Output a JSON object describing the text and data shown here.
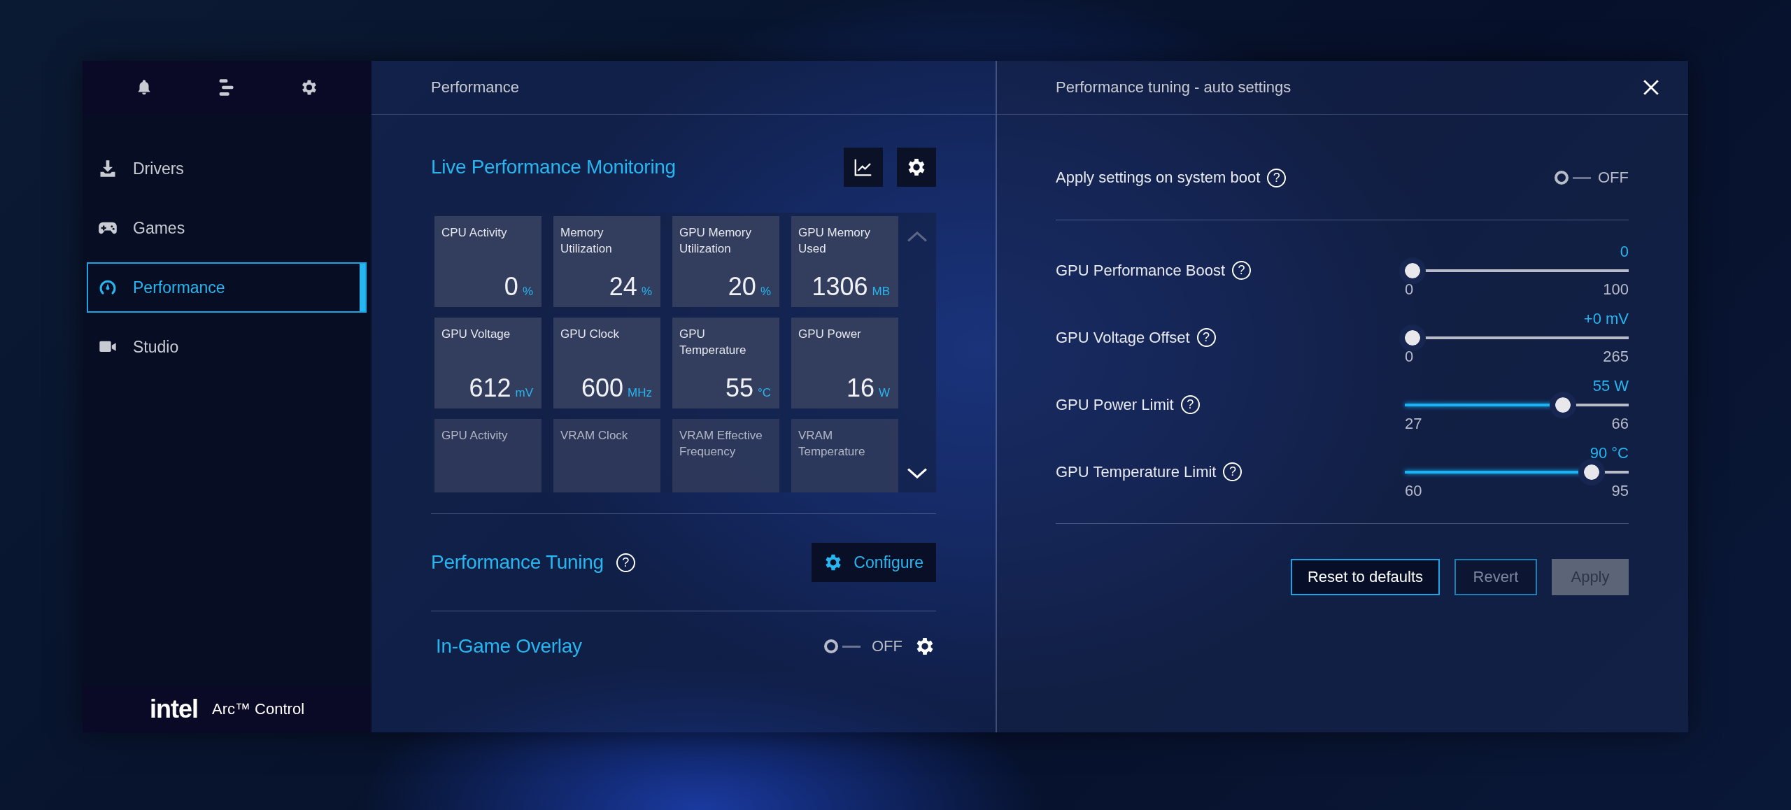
{
  "sidebar": {
    "items": [
      {
        "label": "Drivers",
        "selected": false
      },
      {
        "label": "Games",
        "selected": false
      },
      {
        "label": "Performance",
        "selected": true
      },
      {
        "label": "Studio",
        "selected": false
      }
    ],
    "brand": {
      "logo": "intel",
      "product": "Arc™ Control"
    }
  },
  "center": {
    "title": "Performance",
    "monitoring": {
      "title": "Live Performance Monitoring",
      "tiles": [
        {
          "label": "CPU Activity",
          "value": "0",
          "unit": "%"
        },
        {
          "label": "Memory Utilization",
          "value": "24",
          "unit": "%"
        },
        {
          "label": "GPU Memory Utilization",
          "value": "20",
          "unit": "%"
        },
        {
          "label": "GPU Memory Used",
          "value": "1306",
          "unit": "MB"
        },
        {
          "label": "GPU Voltage",
          "value": "612",
          "unit": "mV"
        },
        {
          "label": "GPU Clock",
          "value": "600",
          "unit": "MHz"
        },
        {
          "label": "GPU Temperature",
          "value": "55",
          "unit": "°C"
        },
        {
          "label": "GPU Power",
          "value": "16",
          "unit": "W"
        },
        {
          "label": "GPU Activity"
        },
        {
          "label": "VRAM Clock"
        },
        {
          "label": "VRAM Effective Frequency"
        },
        {
          "label": "VRAM Temperature"
        }
      ]
    },
    "tuning": {
      "title": "Performance Tuning",
      "help": "?",
      "button": "Configure"
    },
    "overlay": {
      "title": "In-Game Overlay",
      "on": false,
      "state_label": "OFF"
    }
  },
  "right": {
    "title": "Performance tuning - auto settings",
    "boot": {
      "label": "Apply settings on system boot",
      "help": "?",
      "on": false,
      "state_label": "OFF"
    },
    "sliders": [
      {
        "label": "GPU Performance Boost",
        "help": "?",
        "reading": "0",
        "min": "0",
        "max": "100",
        "level": 0
      },
      {
        "label": "GPU Voltage Offset",
        "help": "?",
        "reading": "+0 mV",
        "min": "0",
        "max": "265",
        "level": 0
      },
      {
        "label": "GPU Power Limit",
        "help": "?",
        "reading": "55 W",
        "min": "27",
        "max": "66",
        "level": 0.72
      },
      {
        "label": "GPU Temperature Limit",
        "help": "?",
        "reading": "90 °C",
        "min": "60",
        "max": "95",
        "level": 0.86
      }
    ],
    "buttons": [
      {
        "label": "Reset to defaults",
        "kind": "outline",
        "disabled": false
      },
      {
        "label": "Revert",
        "kind": "outline",
        "disabled": true
      },
      {
        "label": "Apply",
        "kind": "filled",
        "disabled": true
      }
    ]
  }
}
